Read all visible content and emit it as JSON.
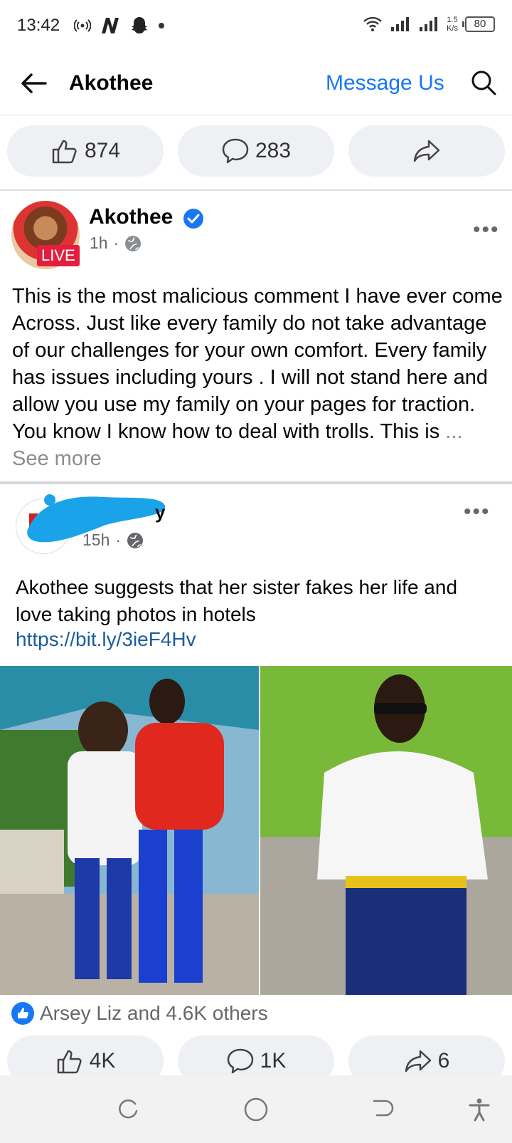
{
  "status_bar": {
    "time": "13:42",
    "net_speed_value": "1.5",
    "net_speed_unit": "K/s",
    "battery": "80",
    "left_icons": [
      "hotspot-icon",
      "n-app-icon",
      "snapchat-icon",
      "dot-icon"
    ],
    "right_icons": [
      "wifi-icon",
      "signal-icon",
      "signal-icon"
    ]
  },
  "header": {
    "title": "Akothee",
    "message_link": "Message Us"
  },
  "top_actions": {
    "likes": "874",
    "comments": "283"
  },
  "post1": {
    "author": "Akothee",
    "live_label": "LIVE",
    "time": "1h",
    "separator": "·",
    "body": "This is the most malicious comment I have ever come Across. Just like every family do not take advantage of our challenges for your own comfort. Every family has issues including yours . I will not stand here and allow you use my family on your pages for traction. You know I know how to deal with trolls. This is ",
    "see_more": "... See more"
  },
  "post2": {
    "author_partial": "y",
    "time": "15h",
    "separator": "·",
    "body": "Akothee suggests that her sister fakes her life and love taking photos in hotels",
    "link": "https://bit.ly/3ieF4Hv",
    "reactions_text": "Arsey Liz and 4.6K others",
    "likes": "4K",
    "comments": "1K",
    "shares": "6"
  },
  "colors": {
    "accent": "#1877f2",
    "link": "#1b5c9e",
    "muted": "#65676b",
    "live": "#e41e3f",
    "pill_bg": "#eef0f3"
  }
}
